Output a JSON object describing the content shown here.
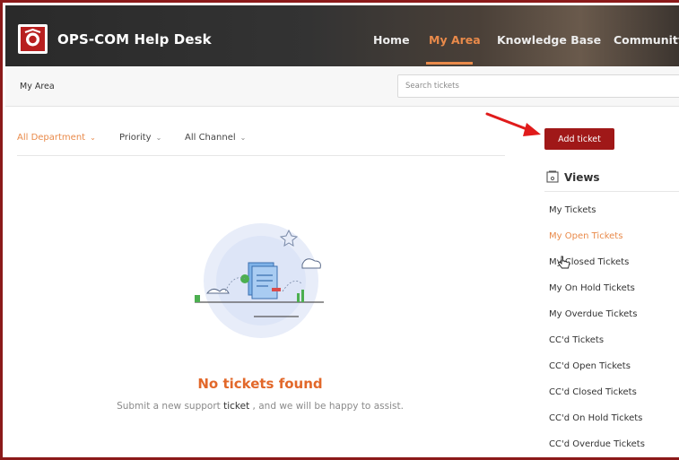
{
  "header": {
    "brand": "OPS-COM Help Desk",
    "nav": [
      {
        "label": "Home",
        "active": false
      },
      {
        "label": "My Area",
        "active": true
      },
      {
        "label": "Knowledge Base",
        "active": false
      },
      {
        "label": "Community",
        "active": false
      }
    ]
  },
  "subbar": {
    "breadcrumb": "My Area",
    "search_placeholder": "Search tickets"
  },
  "filters": [
    {
      "label": "All Department",
      "active": true
    },
    {
      "label": "Priority",
      "active": false
    },
    {
      "label": "All Channel",
      "active": false
    }
  ],
  "empty_state": {
    "title": "No tickets found",
    "subtitle_before": "Submit a new support ",
    "subtitle_link": "ticket",
    "subtitle_after": " , and we will be happy to assist."
  },
  "actions": {
    "add_ticket": "Add ticket"
  },
  "views": {
    "title": "Views",
    "items": [
      {
        "label": "My Tickets",
        "active": false
      },
      {
        "label": "My Open Tickets",
        "active": true
      },
      {
        "label": "My Closed Tickets",
        "active": false
      },
      {
        "label": "My On Hold Tickets",
        "active": false
      },
      {
        "label": "My Overdue Tickets",
        "active": false
      },
      {
        "label": "CC'd Tickets",
        "active": false
      },
      {
        "label": "CC'd Open Tickets",
        "active": false
      },
      {
        "label": "CC'd Closed Tickets",
        "active": false
      },
      {
        "label": "CC'd On Hold Tickets",
        "active": false
      },
      {
        "label": "CC'd Overdue Tickets",
        "active": false
      }
    ]
  },
  "colors": {
    "accent": "#e98a4a",
    "brand_red": "#a01818",
    "border_red": "#8b1a1a",
    "empty_title": "#e2682a"
  }
}
